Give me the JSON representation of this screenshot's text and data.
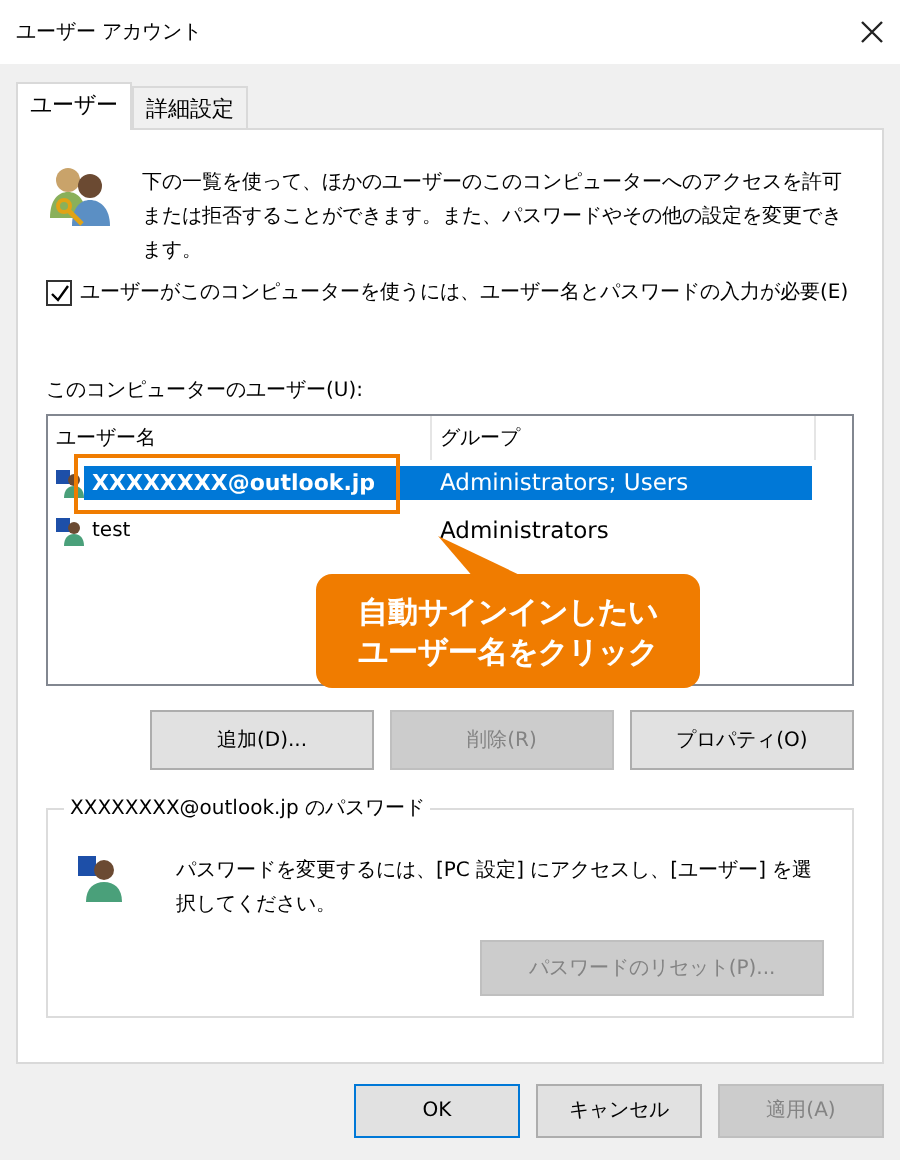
{
  "window": {
    "title": "ユーザー アカウント"
  },
  "tabs": [
    {
      "label": "ユーザー",
      "selected": true
    },
    {
      "label": "詳細設定",
      "selected": false
    }
  ],
  "description": "下の一覧を使って、ほかのユーザーのこのコンピューターへのアクセスを許可または拒否することができます。また、パスワードやその他の設定を変更できます。",
  "require_password": {
    "label": "ユーザーがこのコンピューターを使うには、ユーザー名とパスワードの入力が必要(E)",
    "checked": true
  },
  "users_label": "このコンピューターのユーザー(U):",
  "user_list": {
    "columns": [
      "ユーザー名",
      "グループ"
    ],
    "rows": [
      {
        "name": "XXXXXXXX@outlook.jp",
        "group": "Administrators; Users",
        "selected": true,
        "highlighted": true
      },
      {
        "name": "test",
        "group": "Administrators",
        "selected": false,
        "highlighted": false
      }
    ]
  },
  "callout": [
    "自動サインインしたい",
    "ユーザー名をクリック"
  ],
  "list_buttons": [
    {
      "label": "追加(D)...",
      "disabled": false
    },
    {
      "label": "削除(R)",
      "disabled": true
    },
    {
      "label": "プロパティ(O)",
      "disabled": false
    }
  ],
  "password_group": {
    "title": "XXXXXXXX@outlook.jp のパスワード",
    "text": "パスワードを変更するには、[PC 設定] にアクセスし、[ユーザー] を選択してください。",
    "reset_button": {
      "label": "パスワードのリセット(P)...",
      "disabled": true
    }
  },
  "dialog_buttons": [
    {
      "label": "OK",
      "disabled": false,
      "default": true
    },
    {
      "label": "キャンセル",
      "disabled": false,
      "default": false
    },
    {
      "label": "適用(A)",
      "disabled": true,
      "default": false
    }
  ]
}
